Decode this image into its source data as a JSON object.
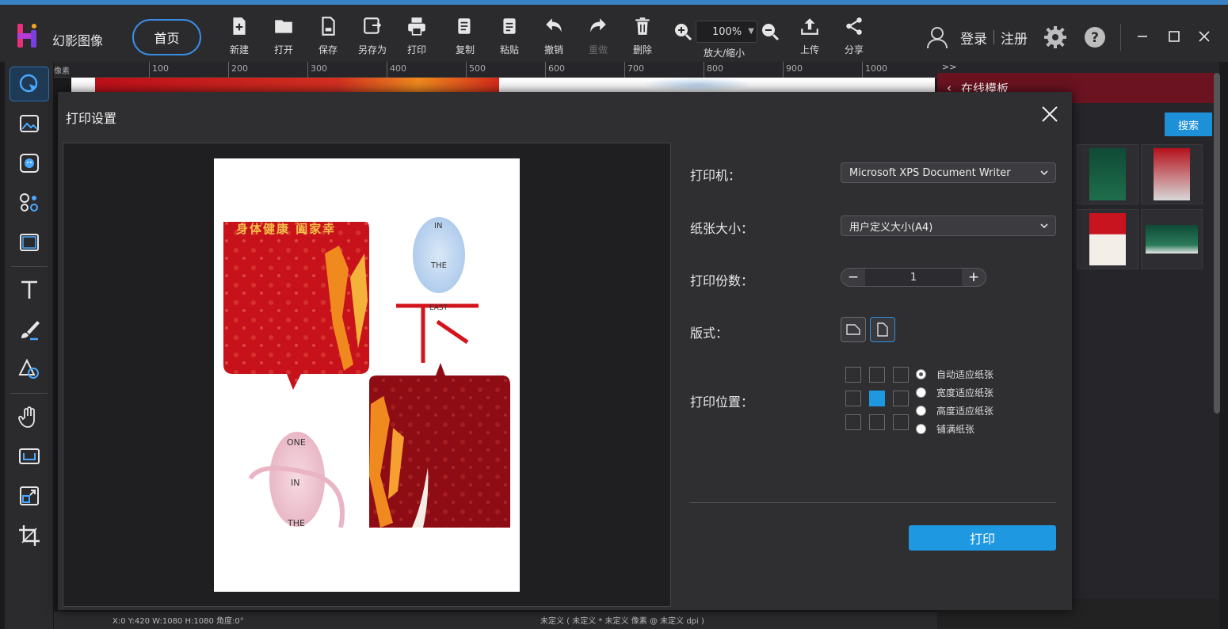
{
  "app": {
    "name": "幻影图像",
    "home_label": "首页"
  },
  "toolbar": {
    "new": "新建",
    "open": "打开",
    "save": "保存",
    "save_as": "另存为",
    "print": "打印",
    "copy": "复制",
    "paste": "粘贴",
    "undo": "撤销",
    "redo": "重做",
    "delete": "删除",
    "zoom_value": "100%",
    "zoom_label": "放大/缩小",
    "upload": "上传",
    "share": "分享"
  },
  "user": {
    "login": "登录",
    "register": "注册"
  },
  "ruler": {
    "unit": "像素",
    "ticks": [
      "100",
      "200",
      "300",
      "400",
      "500",
      "600",
      "700",
      "800",
      "900",
      "1000"
    ]
  },
  "right_panel": {
    "header": ">>",
    "title": "在线模板",
    "search_label": "搜索"
  },
  "status": {
    "coords": "X:0  Y:420  W:1080  H:1080  角度:0°",
    "doc_info": "未定义 ( 未定义 * 未定义 像素 @ 未定义 dpi )"
  },
  "dialog": {
    "title": "打印设置",
    "printer_label": "打印机：",
    "printer_value": "Microsoft XPS Document Writer",
    "paper_label": "纸张大小：",
    "paper_value": "用户定义大小(A4)",
    "copies_label": "打印份数：",
    "copies_value": "1",
    "layout_label": "版式：",
    "position_label": "打印位置：",
    "fit_options": [
      "自动适应纸张",
      "宽度适应纸张",
      "高度适应纸张",
      "铺满纸张"
    ],
    "selected_fit": 0,
    "selected_cell": 4,
    "print_button": "打印"
  },
  "preview": {
    "banner_text": "身体健康  阖家幸",
    "planet1": [
      "IN",
      "THE",
      "EAST"
    ],
    "planet2": [
      "ONE",
      "IN",
      "THE"
    ]
  },
  "colors": {
    "accent": "#1e98e0",
    "brand_red": "#c0101a",
    "panel_red": "#6b1321"
  }
}
